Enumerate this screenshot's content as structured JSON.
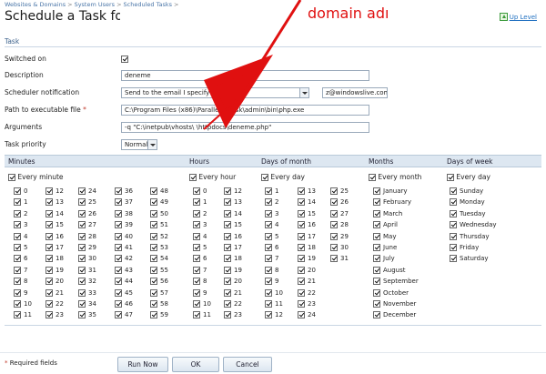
{
  "breadcrumb": {
    "items": [
      "Websites & Domains",
      "System Users",
      "Scheduled Tasks"
    ],
    "separator": ">"
  },
  "page_title": "Schedule a Task for",
  "up_level": "Up Level",
  "section": "Task",
  "fields": {
    "switched_on": {
      "label": "Switched on",
      "checked": true
    },
    "description": {
      "label": "Description",
      "value": "deneme"
    },
    "notification": {
      "label": "Scheduler notification",
      "selected": "Send to the email I specify",
      "email_value": "z@windowslive.com"
    },
    "executable": {
      "label": "Path to executable file",
      "required_mark": "*",
      "value": "C:\\Program Files (x86)\\Parallels\\Plesk\\admin\\bin\\php.exe"
    },
    "arguments": {
      "label": "Arguments",
      "value": "-q \"C:\\inetpub\\vhosts\\                  \\httpdocs\\deneme.php\""
    },
    "priority": {
      "label": "Task priority",
      "selected": "Normal"
    }
  },
  "schedule": {
    "minutes": {
      "header": "Minutes",
      "every_label": "Every minute",
      "every_checked": true
    },
    "hours": {
      "header": "Hours",
      "every_label": "Every hour",
      "every_checked": true
    },
    "days_of_month": {
      "header": "Days of month",
      "every_label": "Every day",
      "every_checked": true
    },
    "months": {
      "header": "Months",
      "every_label": "Every month",
      "every_checked": true,
      "items": [
        "January",
        "February",
        "March",
        "April",
        "May",
        "June",
        "July",
        "August",
        "September",
        "October",
        "November",
        "December"
      ]
    },
    "days_of_week": {
      "header": "Days of week",
      "every_label": "Every day",
      "every_checked": true,
      "items": [
        "Sunday",
        "Monday",
        "Tuesday",
        "Wednesday",
        "Thursday",
        "Friday",
        "Saturday"
      ]
    }
  },
  "footer": {
    "required_note": "Required fields",
    "required_mark": "*",
    "buttons": {
      "run_now": "Run Now",
      "ok": "OK",
      "cancel": "Cancel"
    }
  },
  "annotation": {
    "text": "domain adı",
    "color": "#e01010"
  },
  "icons": {
    "up_level": "up-arrow-icon",
    "checkbox": "checkbox-checked-icon",
    "select": "chevron-down-icon"
  }
}
